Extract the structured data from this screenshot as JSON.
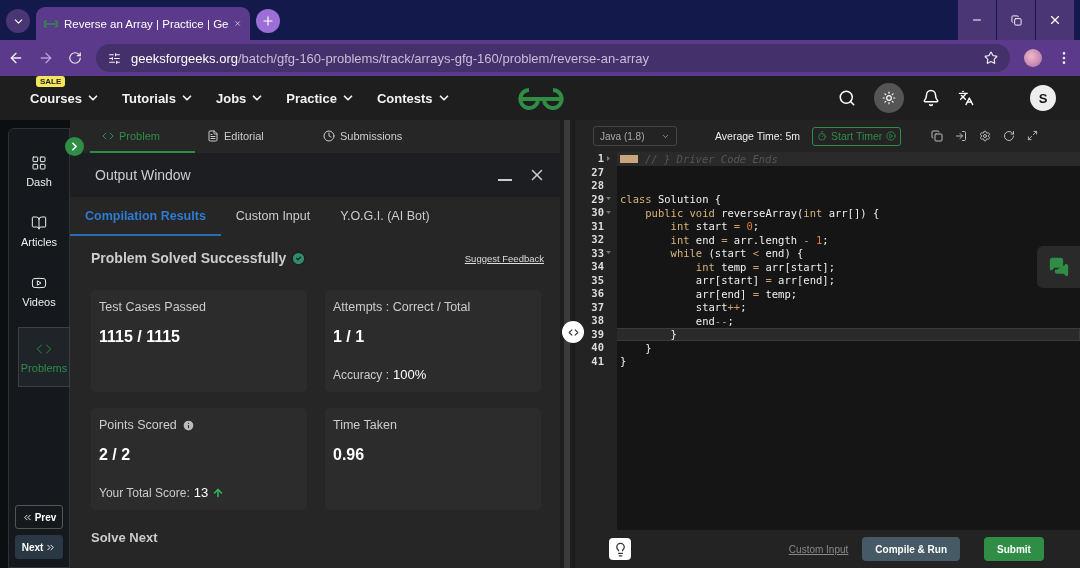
{
  "browser": {
    "tab_title": "Reverse an Array | Practice | Ge",
    "url_host": "geeksforgeeks.org",
    "url_path": "/batch/gfg-160-problems/track/arrays-gfg-160/problem/reverse-an-array"
  },
  "nav": {
    "items": [
      {
        "label": "Courses",
        "badge": "SALE"
      },
      {
        "label": "Tutorials"
      },
      {
        "label": "Jobs"
      },
      {
        "label": "Practice"
      },
      {
        "label": "Contests"
      }
    ],
    "avatar": "S"
  },
  "sidebar": {
    "items": [
      {
        "kind": "dash",
        "label": "Dash",
        "selected": false
      },
      {
        "kind": "articles",
        "label": "Articles",
        "selected": false
      },
      {
        "kind": "videos",
        "label": "Videos",
        "selected": false
      },
      {
        "kind": "problems",
        "label": "Problems",
        "selected": true
      }
    ],
    "prev": "Prev",
    "next": "Next"
  },
  "problem_tabs": [
    {
      "kind": "code",
      "label": "Problem",
      "selected": true
    },
    {
      "kind": "doc",
      "label": "Editorial",
      "selected": false
    },
    {
      "kind": "clock",
      "label": "Submissions",
      "selected": false
    }
  ],
  "output": {
    "title": "Output Window",
    "tabs": [
      {
        "label": "Compilation Results",
        "selected": true
      },
      {
        "label": "Custom Input",
        "selected": false
      },
      {
        "label": "Y.O.G.I. (AI Bot)",
        "selected": false
      }
    ],
    "status": "Problem Solved Successfully",
    "feedback": "Suggest Feedback",
    "cards": [
      {
        "label": "Test Cases Passed",
        "value": "1115 / 1115"
      },
      {
        "label": "Attempts : Correct / Total",
        "value": "1 / 1",
        "extra_label": "Accuracy :",
        "extra_value": "100%"
      },
      {
        "label": "Points Scored",
        "info": true,
        "value": "2 / 2",
        "extra_label": "Your Total Score:",
        "extra_value": "13",
        "rising": true
      },
      {
        "label": "Time Taken",
        "value": "0.96"
      }
    ],
    "solve_next": "Solve Next"
  },
  "editor": {
    "language": "Java (1.8)",
    "average_time": "Average Time: 5m",
    "timer": "Start Timer",
    "lines": [
      {
        "number": "1",
        "folded": true,
        "current": false,
        "segments": [
          {
            "s": "// } Driver Code Ends",
            "kind": "comment"
          }
        ]
      },
      {
        "number": "27",
        "current": false
      },
      {
        "number": "28",
        "current": false
      },
      {
        "number": "29",
        "foldable": true,
        "current": false,
        "segments": [
          {
            "s": "class",
            "kind": "keyword"
          },
          {
            "s": " Solution {",
            "kind": "plain"
          }
        ]
      },
      {
        "number": "30",
        "foldable": true,
        "current": false,
        "segments": [
          {
            "s": "    public void",
            "kind": "keyword"
          },
          {
            "s": " reverseArray(",
            "kind": "plain"
          },
          {
            "s": "int",
            "kind": "keyword"
          },
          {
            "s": " arr[]) {",
            "kind": "plain"
          }
        ]
      },
      {
        "number": "31",
        "current": false,
        "segments": [
          {
            "s": "        int",
            "kind": "keyword"
          },
          {
            "s": " start ",
            "kind": "plain"
          },
          {
            "s": "= ",
            "kind": "operator"
          },
          {
            "s": "0",
            "kind": "number"
          },
          {
            "s": ";",
            "kind": "plain"
          }
        ]
      },
      {
        "number": "32",
        "current": false,
        "segments": [
          {
            "s": "        int",
            "kind": "keyword"
          },
          {
            "s": " end ",
            "kind": "plain"
          },
          {
            "s": "=",
            "kind": "operator"
          },
          {
            "s": " arr.length ",
            "kind": "plain"
          },
          {
            "s": "- ",
            "kind": "operator"
          },
          {
            "s": "1",
            "kind": "number"
          },
          {
            "s": ";",
            "kind": "plain"
          }
        ]
      },
      {
        "number": "33",
        "foldable": true,
        "current": false,
        "segments": [
          {
            "s": "        while",
            "kind": "keyword"
          },
          {
            "s": " (start ",
            "kind": "plain"
          },
          {
            "s": "<",
            "kind": "operator"
          },
          {
            "s": " end) {",
            "kind": "plain"
          }
        ]
      },
      {
        "number": "34",
        "current": false,
        "segments": [
          {
            "s": "            int",
            "kind": "keyword"
          },
          {
            "s": " temp ",
            "kind": "plain"
          },
          {
            "s": "=",
            "kind": "operator"
          },
          {
            "s": " arr[start];",
            "kind": "plain"
          }
        ]
      },
      {
        "number": "35",
        "current": false,
        "segments": [
          {
            "s": "            arr[start] ",
            "kind": "plain"
          },
          {
            "s": "=",
            "kind": "operator"
          },
          {
            "s": " arr[end];",
            "kind": "plain"
          }
        ]
      },
      {
        "number": "36",
        "current": false,
        "segments": [
          {
            "s": "            arr[end] ",
            "kind": "plain"
          },
          {
            "s": "=",
            "kind": "operator"
          },
          {
            "s": " temp;",
            "kind": "plain"
          }
        ]
      },
      {
        "number": "37",
        "current": false,
        "segments": [
          {
            "s": "            start",
            "kind": "plain"
          },
          {
            "s": "++",
            "kind": "operator"
          },
          {
            "s": ";",
            "kind": "plain"
          }
        ]
      },
      {
        "number": "38",
        "current": false,
        "segments": [
          {
            "s": "            end",
            "kind": "plain"
          },
          {
            "s": "--",
            "kind": "operator"
          },
          {
            "s": ";",
            "kind": "plain"
          }
        ]
      },
      {
        "number": "39",
        "current": true,
        "segments": [
          {
            "s": "        }",
            "kind": "plain"
          }
        ]
      },
      {
        "number": "40",
        "current": false,
        "segments": [
          {
            "s": "    }",
            "kind": "plain"
          }
        ]
      },
      {
        "number": "41",
        "current": false,
        "segments": [
          {
            "s": "}",
            "kind": "plain"
          }
        ]
      }
    ],
    "custom_input": "Custom Input",
    "compile": "Compile & Run",
    "submit": "Submit"
  }
}
